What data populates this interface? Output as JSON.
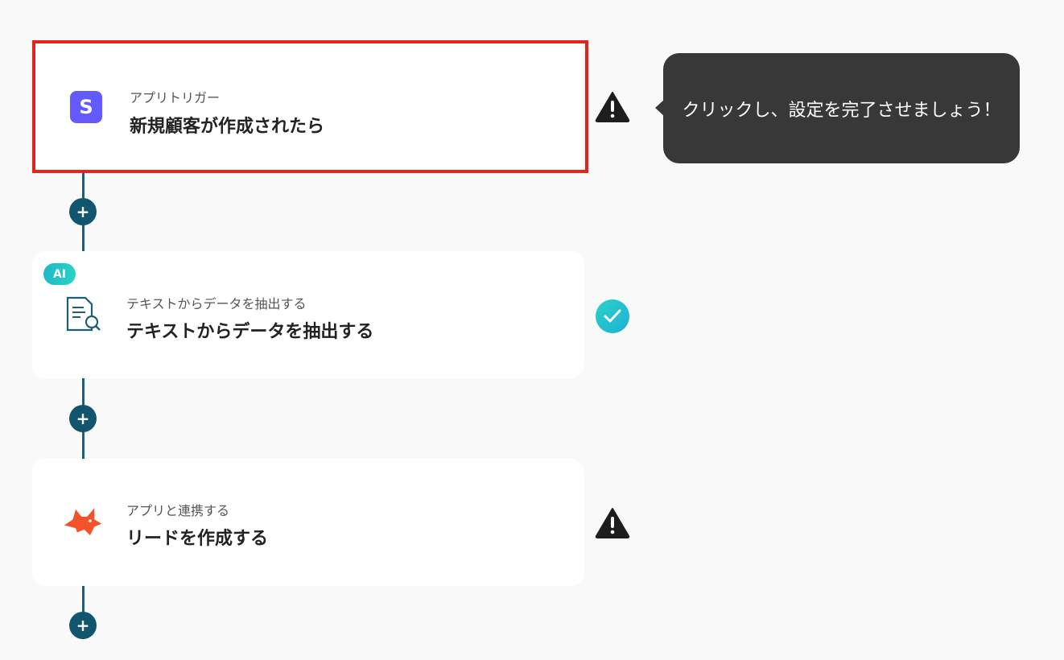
{
  "tooltip": {
    "text": "クリックし、設定を完了させましょう！"
  },
  "steps": [
    {
      "subtitle": "アプリトリガー",
      "title": "新規顧客が作成されたら",
      "icon": "stripe-logo-icon",
      "status": "warning",
      "selected": true
    },
    {
      "badge": "AI",
      "subtitle": "テキストからデータを抽出する",
      "title": "テキストからデータを抽出する",
      "icon": "document-search-icon",
      "status": "complete"
    },
    {
      "subtitle": "アプリと連携する",
      "title": "リードを作成する",
      "icon": "fox-logo-icon",
      "status": "warning"
    }
  ],
  "colors": {
    "connector": "#1d5f78",
    "plus_button": "#12566e",
    "selected_border": "#e4241b",
    "tooltip_bg": "#383838",
    "stripe_purple": "#635bff",
    "check_teal": "#22c1d6",
    "fox_orange": "#f4522b"
  }
}
